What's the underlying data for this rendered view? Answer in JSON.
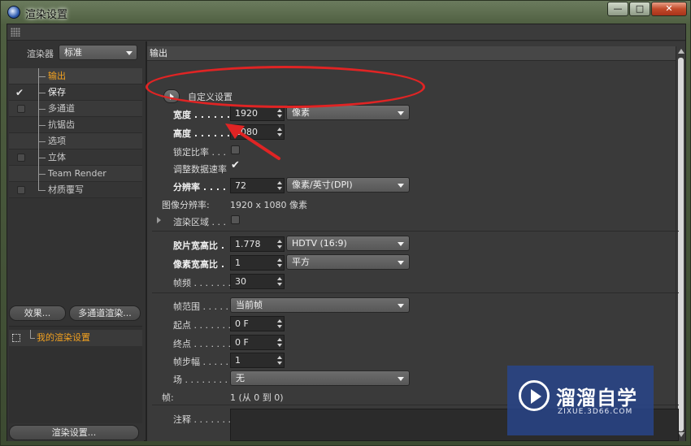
{
  "window": {
    "title": "渲染设置"
  },
  "left": {
    "renderer_label": "渲染器",
    "renderer_value": "标准",
    "tree": [
      {
        "label": "输出",
        "checked": false,
        "has_checkbox": false,
        "color": "orange"
      },
      {
        "label": "保存",
        "checked": true,
        "has_checkbox": false,
        "color": "orange"
      },
      {
        "label": "多通道",
        "checked": false,
        "has_checkbox": true,
        "color": "normal"
      },
      {
        "label": "抗锯齿",
        "checked": false,
        "has_checkbox": false,
        "color": "normal"
      },
      {
        "label": "选项",
        "checked": false,
        "has_checkbox": false,
        "color": "normal"
      },
      {
        "label": "立体",
        "checked": false,
        "has_checkbox": true,
        "color": "normal"
      },
      {
        "label": "Team Render",
        "checked": false,
        "has_checkbox": false,
        "color": "normal"
      },
      {
        "label": "材质覆写",
        "checked": false,
        "has_checkbox": true,
        "color": "normal"
      }
    ],
    "effects_button": "效果...",
    "multipass_button": "多通道渲染...",
    "preset_item": "我的渲染设置",
    "render_settings_button": "渲染设置..."
  },
  "right": {
    "section_title": "输出",
    "custom_settings": "自定义设置",
    "width": {
      "label": "宽度 . . . . . . .",
      "value": "1920",
      "unit": "像素"
    },
    "height": {
      "label": "高度 . . . . . . .",
      "value": "1080"
    },
    "lock_ratio": {
      "label": "锁定比率 . . .",
      "checked": false
    },
    "adjust_rate": {
      "label": "调整数据速率",
      "checked": true
    },
    "resolution": {
      "label": "分辨率 . . . . .",
      "value": "72",
      "unit": "像素/英寸(DPI)"
    },
    "image_resolution": {
      "label": "图像分辨率:",
      "value": "1920 x 1080 像素"
    },
    "render_region": {
      "label": "渲染区域 . . .",
      "checked": false
    },
    "film_aspect": {
      "label": "胶片宽高比 .",
      "value": "1.778",
      "preset": "HDTV (16:9)"
    },
    "pixel_aspect": {
      "label": "像素宽高比 .",
      "value": "1",
      "preset": "平方"
    },
    "frame_rate": {
      "label": "帧频 . . . . . . .",
      "value": "30"
    },
    "frame_range": {
      "label": "帧范围 . . . . .",
      "value": "当前帧"
    },
    "start": {
      "label": "起点 . . . . . . .",
      "value": "0 F"
    },
    "end": {
      "label": "终点 . . . . . . .",
      "value": "0 F"
    },
    "frame_step": {
      "label": "帧步幅 . . . . .",
      "value": "1"
    },
    "field": {
      "label": "场 . . . . . . . . .",
      "value": "无"
    },
    "frames": {
      "label": "帧:",
      "value": "1 (从 0 到 0)"
    },
    "notes": {
      "label": "注释 . . . . . . ."
    }
  },
  "watermark": {
    "title": "溜溜自学",
    "url": "ZIXUE.3D66.COM"
  },
  "colors": {
    "accent": "#f0a020",
    "annotation": "#e02424",
    "panel": "#3a3a3a"
  }
}
